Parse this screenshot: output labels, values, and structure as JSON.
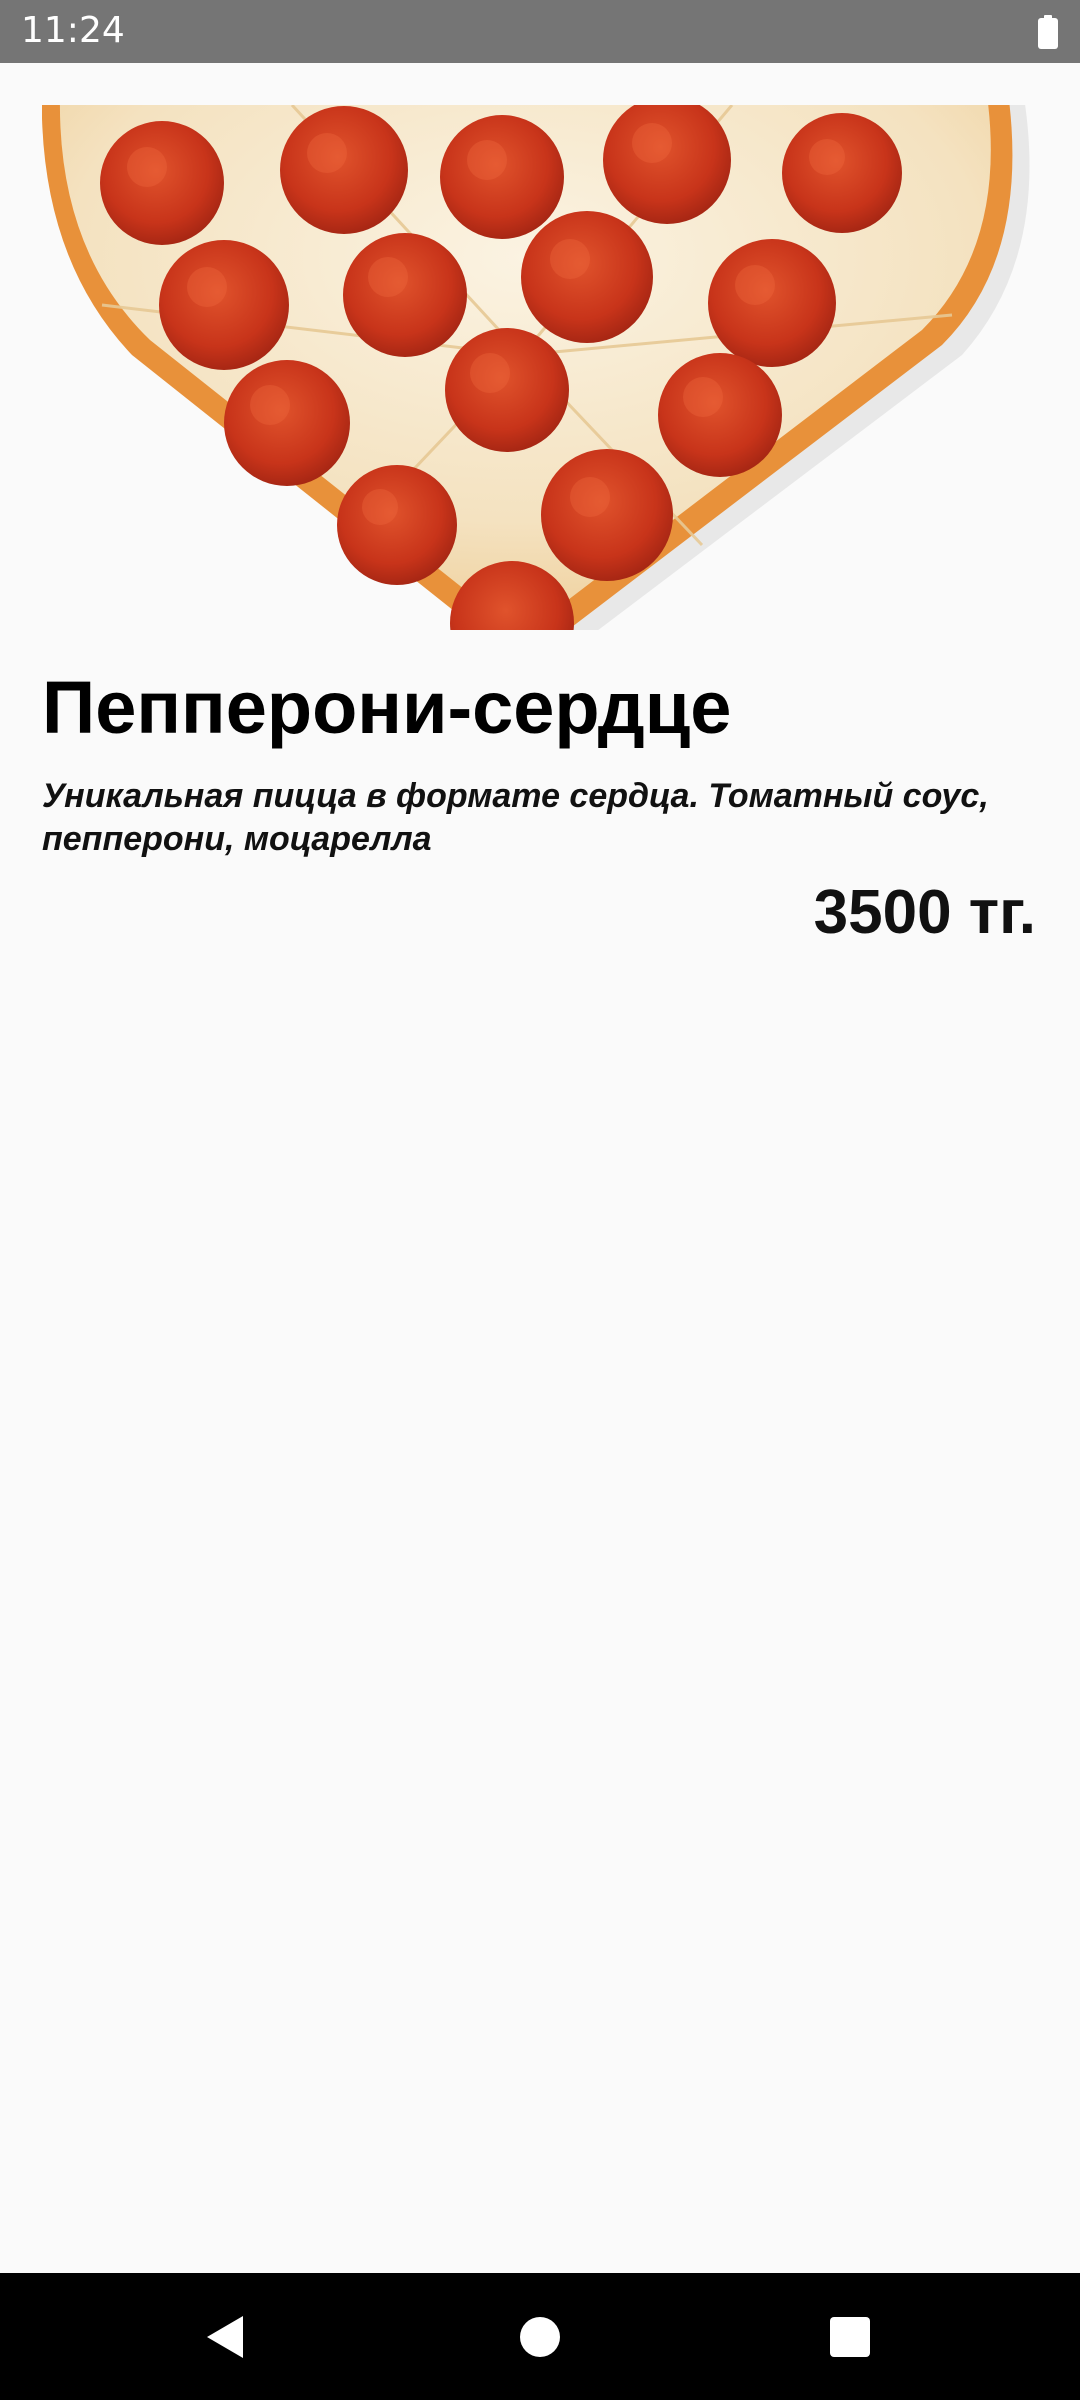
{
  "status_bar": {
    "time": "11:24",
    "icons": [
      "battery-icon"
    ]
  },
  "product": {
    "image": "pepperoni-heart-pizza-image",
    "title": "Пепперони-сердце",
    "description": "Уникальная пицца в формате сердца. Томатный соус, пепперони, моцарелла",
    "price": "3500 тг."
  },
  "nav_bar": {
    "buttons": [
      "back-icon",
      "home-icon",
      "recents-icon"
    ]
  },
  "colors": {
    "status_bar": "#757575",
    "background": "#fafafa",
    "nav_bar": "#000000",
    "crust": "#e8913a",
    "cheese": "#f6ead2",
    "pepperoni": "#c8341a"
  }
}
